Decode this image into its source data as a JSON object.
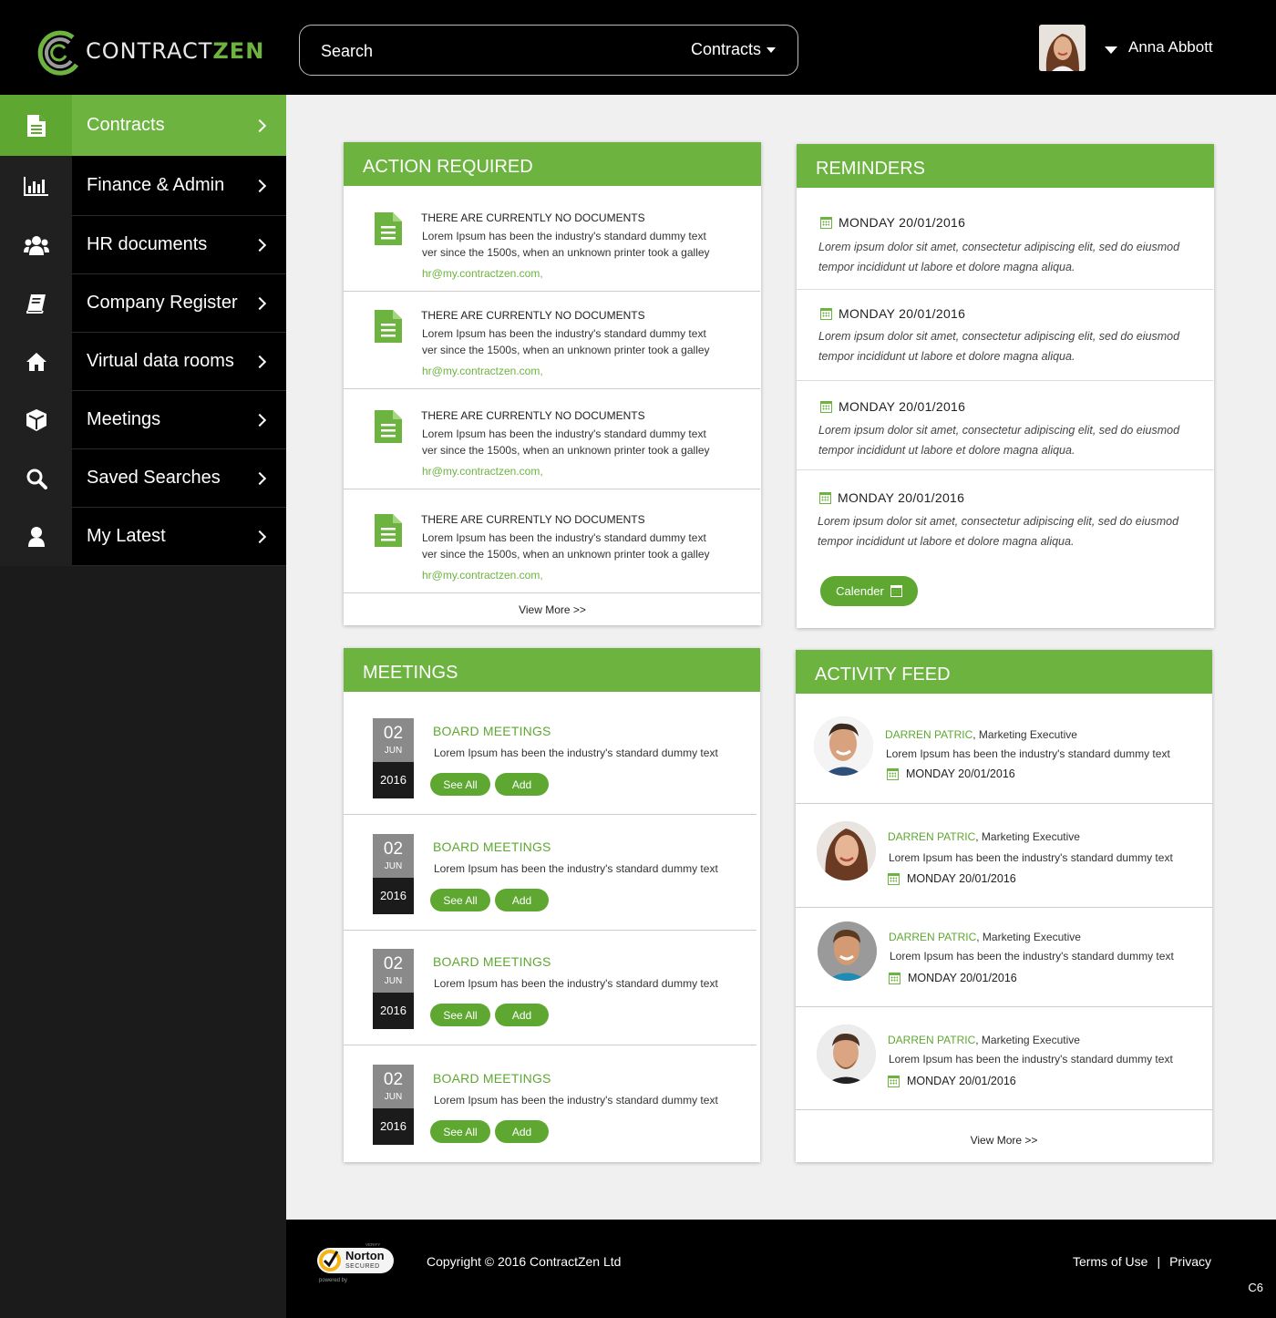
{
  "brand": {
    "part1": "CONTRACT",
    "part2": "ZEN",
    "accent": "#6db33f"
  },
  "search": {
    "placeholder": "Search",
    "scope": "Contracts"
  },
  "user": {
    "name": "Anna Abbott"
  },
  "sidebar": {
    "items": [
      {
        "label": "Contracts",
        "icon": "document-icon"
      },
      {
        "label": "Finance & Admin",
        "icon": "bar-chart-icon"
      },
      {
        "label": "HR documents",
        "icon": "users-icon"
      },
      {
        "label": "Company Register",
        "icon": "book-icon"
      },
      {
        "label": "Virtual data rooms",
        "icon": "home-icon"
      },
      {
        "label": "Meetings",
        "icon": "cube-icon"
      },
      {
        "label": "Saved Searches",
        "icon": "search-icon"
      },
      {
        "label": "My Latest",
        "icon": "user-icon"
      }
    ]
  },
  "action_required": {
    "title": "ACTION REQUIRED",
    "items": [
      {
        "title": "THERE ARE CURRENTLY NO DOCUMENTS",
        "line1": "Lorem Ipsum has been the industry's standard dummy text",
        "line2": "ver since the 1500s, when an unknown printer took a galley",
        "email": "hr@my.contractzen.com,"
      },
      {
        "title": "THERE ARE CURRENTLY NO DOCUMENTS",
        "line1": "Lorem Ipsum has been the industry's standard dummy text",
        "line2": "ver since the 1500s, when an unknown printer took a galley",
        "email": "hr@my.contractzen.com,"
      },
      {
        "title": "THERE ARE CURRENTLY NO DOCUMENTS",
        "line1": "Lorem Ipsum has been the industry's standard dummy text",
        "line2": "ver since the 1500s, when an unknown printer took a galley",
        "email": "hr@my.contractzen.com,"
      },
      {
        "title": "THERE ARE CURRENTLY NO DOCUMENTS",
        "line1": "Lorem Ipsum has been the industry's standard dummy text",
        "line2": "ver since the 1500s, when an unknown printer took a galley",
        "email": "hr@my.contractzen.com,"
      }
    ],
    "view_more": "View More >>"
  },
  "reminders": {
    "title": "REMINDERS",
    "items": [
      {
        "date": "MONDAY  20/01/2016",
        "line1": "Lorem ipsum dolor sit amet, consectetur adipiscing elit, sed do eiusmod",
        "line2": "tempor incididunt ut labore et dolore magna aliqua."
      },
      {
        "date": "MONDAY  20/01/2016",
        "line1": "Lorem ipsum dolor sit amet, consectetur adipiscing elit, sed do eiusmod",
        "line2": "tempor incididunt ut labore et dolore magna aliqua."
      },
      {
        "date": "MONDAY  20/01/2016",
        "line1": "Lorem ipsum dolor sit amet, consectetur adipiscing elit, sed do eiusmod",
        "line2": "tempor incididunt ut labore et dolore magna aliqua."
      },
      {
        "date": "MONDAY  20/01/2016",
        "line1": "Lorem ipsum dolor sit amet, consectetur adipiscing elit, sed do eiusmod",
        "line2": "tempor incididunt ut labore et dolore magna aliqua."
      }
    ],
    "calendar_button": "Calender"
  },
  "meetings": {
    "title": "MEETINGS",
    "items": [
      {
        "day": "02",
        "month": "JUN",
        "year": "2016",
        "title": "BOARD MEETINGS",
        "desc": "Lorem Ipsum has been the industry's standard dummy text",
        "see_all": "See All",
        "add": "Add"
      },
      {
        "day": "02",
        "month": "JUN",
        "year": "2016",
        "title": "BOARD MEETINGS",
        "desc": "Lorem Ipsum has been the industry's standard dummy text",
        "see_all": "See All",
        "add": "Add"
      },
      {
        "day": "02",
        "month": "JUN",
        "year": "2016",
        "title": "BOARD MEETINGS",
        "desc": "Lorem Ipsum has been the industry's standard dummy text",
        "see_all": "See All",
        "add": "Add"
      },
      {
        "day": "02",
        "month": "JUN",
        "year": "2016",
        "title": "BOARD MEETINGS",
        "desc": "Lorem Ipsum has been the industry's standard dummy text",
        "see_all": "See All",
        "add": "Add"
      }
    ]
  },
  "activity_feed": {
    "title": "ACTIVITY FEED",
    "items": [
      {
        "name": "DARREN PATRIC",
        "role": ", Marketing Executive",
        "desc": "Lorem Ipsum has been the industry's standard dummy text",
        "date": "MONDAY  20/01/2016"
      },
      {
        "name": "DARREN PATRIC",
        "role": ", Marketing Executive",
        "desc": "Lorem Ipsum has been the industry's standard dummy text",
        "date": "MONDAY  20/01/2016"
      },
      {
        "name": "DARREN PATRIC",
        "role": ", Marketing Executive",
        "desc": "Lorem Ipsum has been the industry's standard dummy text",
        "date": "MONDAY  20/01/2016"
      },
      {
        "name": "DARREN PATRIC",
        "role": ", Marketing Executive",
        "desc": "Lorem Ipsum has been the industry's standard dummy text",
        "date": "MONDAY  20/01/2016"
      }
    ],
    "view_more": "View More >>"
  },
  "footer": {
    "badge_top": "VERIFY",
    "badge_name": "Norton",
    "badge_sub": "SECURED",
    "badge_bottom": "powered by",
    "copyright": "Copyright © 2016 ContractZen Ltd",
    "terms": "Terms of Use",
    "separator": "|",
    "privacy": "Privacy",
    "code": "C6"
  }
}
